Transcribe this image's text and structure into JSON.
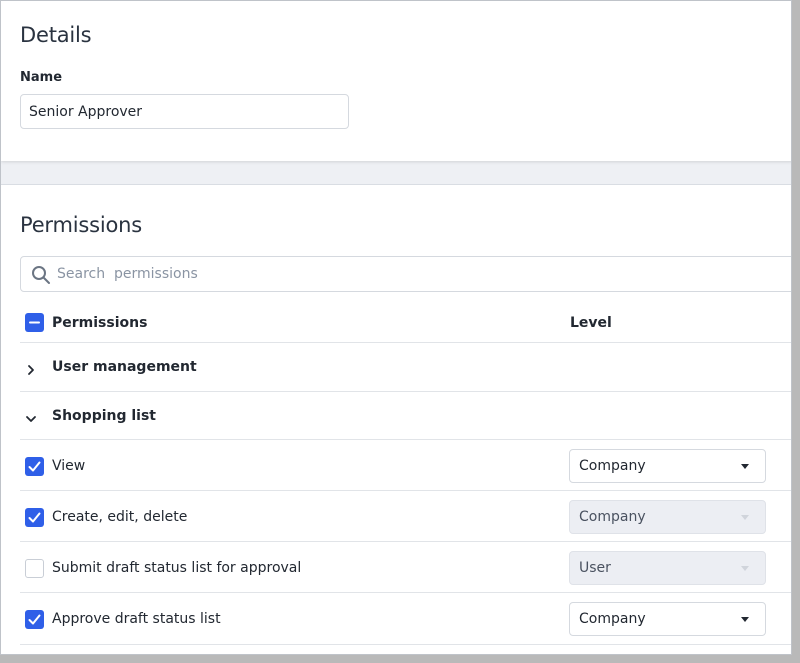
{
  "details": {
    "title": "Details",
    "name_label": "Name",
    "name_value": "Senior Approver"
  },
  "permissions": {
    "title": "Permissions",
    "search_placeholder": "Search  permissions",
    "header": {
      "permissions_label": "Permissions",
      "level_label": "Level"
    },
    "groups": [
      {
        "label": "User management",
        "expanded": false
      },
      {
        "label": "Shopping list",
        "expanded": true
      }
    ],
    "items": [
      {
        "label": "View",
        "checked": true,
        "level": "Company",
        "level_enabled": true
      },
      {
        "label": "Create, edit, delete",
        "checked": true,
        "level": "Company",
        "level_enabled": false
      },
      {
        "label": "Submit draft status list for approval",
        "checked": false,
        "level": "User",
        "level_enabled": false
      },
      {
        "label": "Approve draft status list",
        "checked": true,
        "level": "Company",
        "level_enabled": true
      }
    ]
  },
  "colors": {
    "accent": "#2f5fe8",
    "background": "#eef0f4",
    "disabled_select": "#eceef3"
  }
}
